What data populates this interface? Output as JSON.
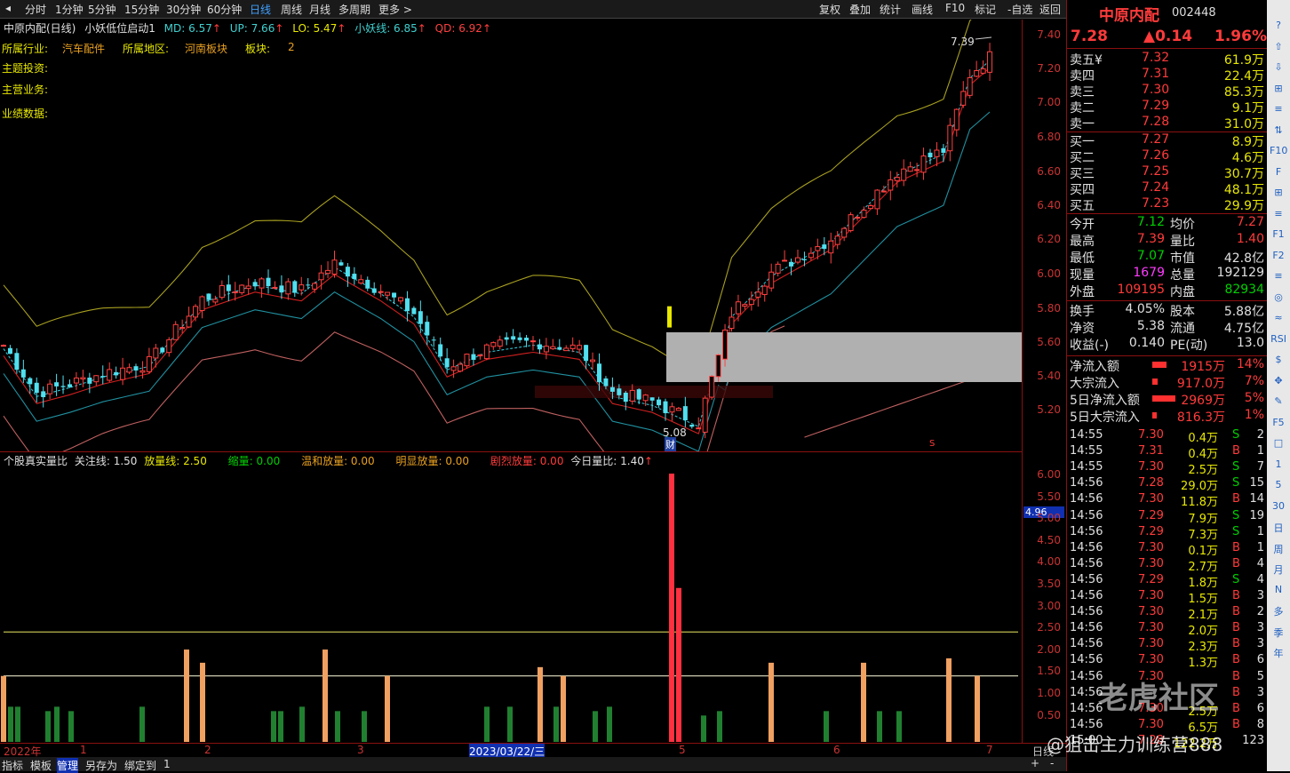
{
  "toolbar": {
    "periods": [
      "分时",
      "1分钟",
      "5分钟",
      "15分钟",
      "30分钟",
      "60分钟",
      "日线",
      "周线",
      "月线",
      "多周期",
      "更多 >"
    ],
    "active": "日线",
    "right_buttons": [
      "复权",
      "叠加",
      "统计",
      "画线",
      "F10",
      "标记",
      "-自选",
      "返回"
    ]
  },
  "chart_header": {
    "name": "中原内配(日线)",
    "indicator": "小妖低位启动1",
    "md": "MD: 6.57",
    "up": "UP: 7.66",
    "lo": "LO: 5.47",
    "xyx": "小妖线: 6.85",
    "qd": "QD: 6.92"
  },
  "info": {
    "industry_label": "所属行业:",
    "industry": "汽车配件",
    "region_label": "所属地区:",
    "region": "河南板块",
    "board_label": "板块:",
    "board": "2",
    "invest_label": "主题投资:",
    "business_label": "主营业务:",
    "perf_label": "业绩数据:"
  },
  "annotations": {
    "high": "7.39",
    "low": "5.08",
    "cai": "财",
    "s_mark": "S"
  },
  "main_yaxis": [
    "7.40",
    "7.20",
    "7.00",
    "6.80",
    "6.60",
    "6.40",
    "6.20",
    "6.00",
    "5.80",
    "5.60",
    "5.40",
    "5.20"
  ],
  "sub_header": {
    "name": "个股真实量比",
    "gz": "关注线: 1.50",
    "fl": "放量线: 2.50",
    "sl": "缩量: 0.00",
    "wh": "温和放量: 0.00",
    "mx": "明显放量: 0.00",
    "jl": "剧烈放量: 0.00",
    "jr": "今日量比: 1.40"
  },
  "sub_yaxis": [
    "6.00",
    "5.50",
    "5.00",
    "4.50",
    "4.00",
    "3.50",
    "3.00",
    "2.50",
    "2.00",
    "1.50",
    "1.00",
    "0.50"
  ],
  "sub_marker": "4.96",
  "xaxis": {
    "labels": [
      "2022年",
      "1",
      "2",
      "3",
      "2023/03/22/三",
      "5",
      "6",
      "7"
    ],
    "right": "日线"
  },
  "bottom_tabs": [
    "指标",
    "模板",
    "管理",
    "另存为",
    "绑定到",
    "1"
  ],
  "bottom_right": [
    "+",
    "-"
  ],
  "quote": {
    "name": "中原内配",
    "code": "002448",
    "price": "7.28",
    "change": "▲0.14",
    "pct": "1.96%"
  },
  "sells": [
    {
      "label": "卖五¥",
      "price": "7.32",
      "vol": "61.9万"
    },
    {
      "label": "卖四",
      "price": "7.31",
      "vol": "22.4万"
    },
    {
      "label": "卖三",
      "price": "7.30",
      "vol": "85.3万"
    },
    {
      "label": "卖二",
      "price": "7.29",
      "vol": "9.1万"
    },
    {
      "label": "卖一",
      "price": "7.28",
      "vol": "31.0万"
    }
  ],
  "buys": [
    {
      "label": "买一",
      "price": "7.27",
      "vol": "8.9万"
    },
    {
      "label": "买二",
      "price": "7.26",
      "vol": "4.6万"
    },
    {
      "label": "买三",
      "price": "7.25",
      "vol": "30.7万"
    },
    {
      "label": "买四",
      "price": "7.24",
      "vol": "48.1万"
    },
    {
      "label": "买五",
      "price": "7.23",
      "vol": "29.9万"
    }
  ],
  "stats": [
    {
      "l1": "今开",
      "v1": "7.12",
      "l2": "均价",
      "v2": "7.27"
    },
    {
      "l1": "最高",
      "v1": "7.39",
      "l2": "量比",
      "v2": "1.40"
    },
    {
      "l1": "最低",
      "v1": "7.07",
      "l2": "市值",
      "v2": "42.8亿"
    },
    {
      "l1": "现量",
      "v1": "1679",
      "l2": "总量",
      "v2": "192129"
    },
    {
      "l1": "外盘",
      "v1": "109195",
      "l2": "内盘",
      "v2": "82934"
    }
  ],
  "stats2": [
    {
      "l1": "换手",
      "v1": "4.05%",
      "l2": "股本",
      "v2": "5.88亿"
    },
    {
      "l1": "净资",
      "v1": "5.38",
      "l2": "流通",
      "v2": "4.75亿"
    },
    {
      "l1": "收益(-)",
      "v1": "0.140",
      "l2": "PE(动)",
      "v2": "13.0"
    }
  ],
  "flows": [
    {
      "label": "净流入额",
      "val": "1915万",
      "pct": "14%"
    },
    {
      "label": "大宗流入",
      "val": "917.0万",
      "pct": "7%"
    },
    {
      "label": "5日净流入额",
      "val": "2969万",
      "pct": "5%"
    },
    {
      "label": "5日大宗流入",
      "val": "816.3万",
      "pct": "1%"
    }
  ],
  "trades": [
    {
      "t": "14:55",
      "p": "7.30",
      "v": "0.4万",
      "bs": "S",
      "n": "2"
    },
    {
      "t": "14:55",
      "p": "7.31",
      "v": "0.4万",
      "bs": "B",
      "n": "1"
    },
    {
      "t": "14:55",
      "p": "7.30",
      "v": "2.5万",
      "bs": "S",
      "n": "7"
    },
    {
      "t": "14:56",
      "p": "7.28",
      "v": "29.0万",
      "bs": "S",
      "n": "15"
    },
    {
      "t": "14:56",
      "p": "7.30",
      "v": "11.8万",
      "bs": "B",
      "n": "14"
    },
    {
      "t": "14:56",
      "p": "7.29",
      "v": "7.9万",
      "bs": "S",
      "n": "19"
    },
    {
      "t": "14:56",
      "p": "7.29",
      "v": "7.3万",
      "bs": "S",
      "n": "1"
    },
    {
      "t": "14:56",
      "p": "7.30",
      "v": "0.1万",
      "bs": "B",
      "n": "1"
    },
    {
      "t": "14:56",
      "p": "7.30",
      "v": "2.7万",
      "bs": "B",
      "n": "4"
    },
    {
      "t": "14:56",
      "p": "7.29",
      "v": "1.8万",
      "bs": "S",
      "n": "4"
    },
    {
      "t": "14:56",
      "p": "7.30",
      "v": "1.5万",
      "bs": "B",
      "n": "3"
    },
    {
      "t": "14:56",
      "p": "7.30",
      "v": "2.1万",
      "bs": "B",
      "n": "2"
    },
    {
      "t": "14:56",
      "p": "7.30",
      "v": "2.0万",
      "bs": "B",
      "n": "3"
    },
    {
      "t": "14:56",
      "p": "7.30",
      "v": "2.3万",
      "bs": "B",
      "n": "3"
    },
    {
      "t": "14:56",
      "p": "7.30",
      "v": "1.3万",
      "bs": "B",
      "n": "6"
    },
    {
      "t": "14:56",
      "p": "7.30",
      "v": "",
      "bs": "B",
      "n": "5"
    },
    {
      "t": "14:56",
      "p": "",
      "v": "",
      "bs": "B",
      "n": "3"
    },
    {
      "t": "14:56",
      "p": "7.30",
      "v": "2.5万",
      "bs": "B",
      "n": "6"
    },
    {
      "t": "14:56",
      "p": "7.30",
      "v": "6.5万",
      "bs": "B",
      "n": "8"
    },
    {
      "t": "15:00",
      "p": "7.28",
      "v": "122.2万",
      "bs": "",
      "n": "123"
    }
  ],
  "side_icons": [
    "?",
    "⇧",
    "⇩",
    "⊞",
    "≡",
    "⇅",
    "F10",
    "F",
    "⊞",
    "≡",
    "F1",
    "F2",
    "≡",
    "◎",
    "≈",
    "RSI",
    "$",
    "✥",
    "✎",
    "F5",
    "□",
    "1",
    "5",
    "30",
    "日",
    "周",
    "月",
    "N",
    "多",
    "季",
    "年"
  ],
  "watermark": "老虎社区",
  "watermark2": "@狙击主力训练营888"
}
